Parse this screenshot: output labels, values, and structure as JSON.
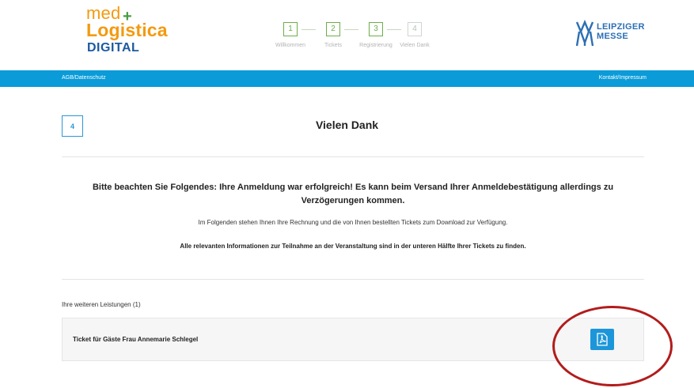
{
  "logo": {
    "line1": "med",
    "plus": "+",
    "line2": "Logistica",
    "line3": "DIGITAL"
  },
  "steps": [
    {
      "num": "1",
      "label": "Willkommen",
      "state": "done"
    },
    {
      "num": "2",
      "label": "Tickets",
      "state": "done"
    },
    {
      "num": "3",
      "label": "Registrierung",
      "state": "done"
    },
    {
      "num": "4",
      "label": "Vielen Dank",
      "state": "inactive"
    }
  ],
  "brand": {
    "line1": "LEIPZIGER",
    "line2": "MESSE"
  },
  "nav": {
    "left_link": "AGB/Datenschutz",
    "right_link": "Kontakt/Impressum"
  },
  "page": {
    "step_number": "4",
    "title": "Vielen Dank",
    "notice": "Bitte beachten Sie Folgendes: Ihre Anmeldung war erfolgreich! Es kann beim Versand Ihrer Anmeldebestätigung allerdings zu Verzögerungen kommen.",
    "info": "Im Folgenden stehen Ihnen Ihre Rechnung und die von Ihnen bestellten Tickets zum Download zur Verfügung.",
    "info_bold": "Alle relevanten Informationen zur Teilnahme an der Veranstaltung sind in der unteren Hälfte Ihrer Tickets zu finden.",
    "services_label": "Ihre weiteren Leistungen (1)",
    "ticket_name": "Ticket für Gäste Frau Annemarie Schlegel"
  },
  "icons": {
    "download": "pdf-icon"
  },
  "colors": {
    "accent": "#0a9bd8",
    "step_active": "#6cae48",
    "highlight": "#b21c1c"
  }
}
